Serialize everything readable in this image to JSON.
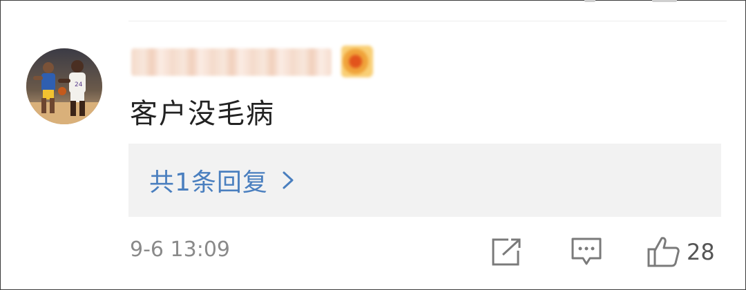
{
  "comment": {
    "username": "",
    "text": "客户没毛病",
    "reply_summary": "共1条回复",
    "timestamp": "9-6 13:09",
    "like_count": "28"
  },
  "icons": {
    "avatar": "avatar-basketball-players",
    "badge": "level-badge",
    "reply_chevron": "chevron-right-icon",
    "share": "share-icon",
    "comment": "comment-icon",
    "like": "thumbs-up-icon"
  },
  "colors": {
    "link": "#4a7fbf",
    "reply_bg": "#f2f2f2",
    "meta_text": "#8a8a8a",
    "icon": "#7a7a7a"
  }
}
